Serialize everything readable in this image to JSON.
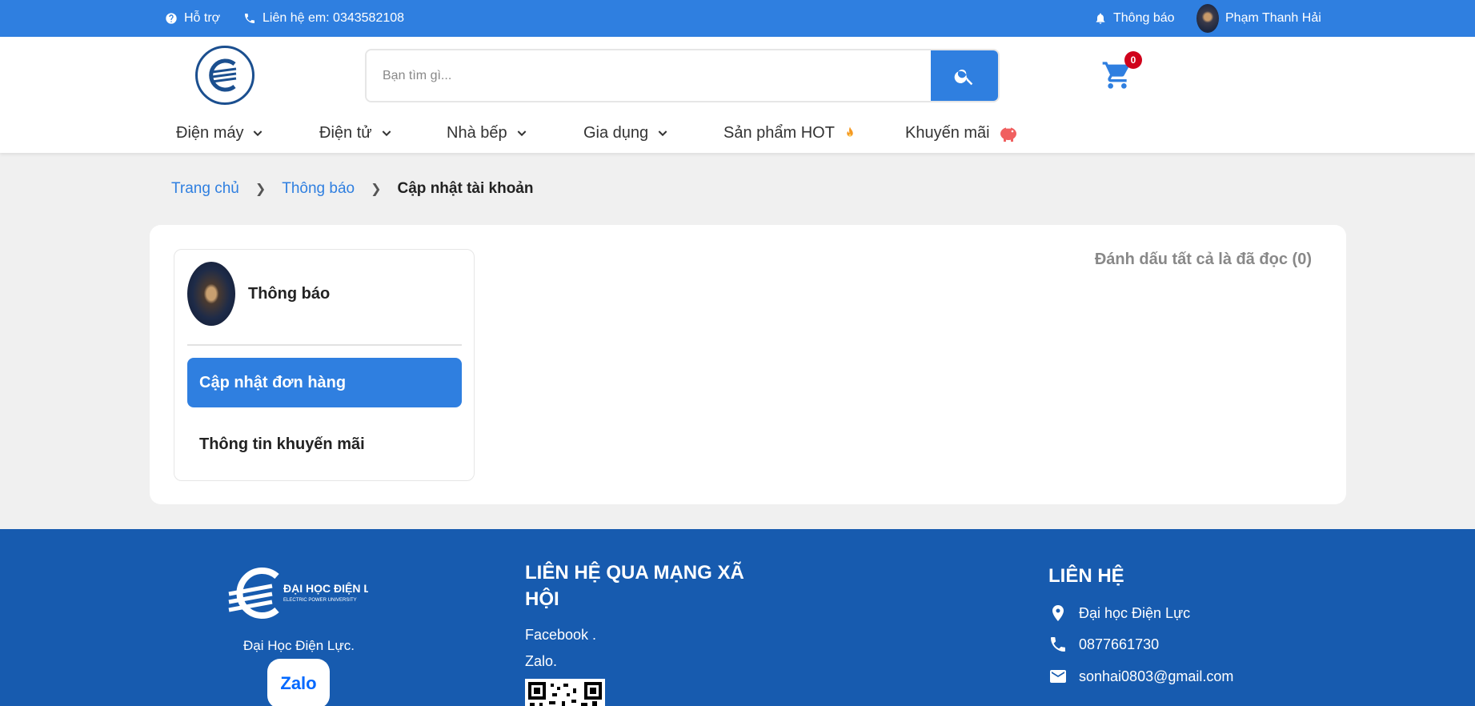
{
  "topbar": {
    "support_label": "Hỗ trợ",
    "contact_label": "Liên hệ em: 0343582108",
    "notify_label": "Thông báo",
    "user_name": "Phạm Thanh Hải"
  },
  "header": {
    "search_placeholder": "Bạn tìm gì...",
    "cart_count": "0",
    "nav": [
      {
        "label": "Điện máy",
        "icon": "chevron-down-icon"
      },
      {
        "label": "Điện tử",
        "icon": "chevron-down-icon"
      },
      {
        "label": "Nhà bếp",
        "icon": "chevron-down-icon"
      },
      {
        "label": "Gia dụng",
        "icon": "chevron-down-icon"
      },
      {
        "label": "Sản phẩm HOT",
        "icon": "fire-icon"
      },
      {
        "label": "Khuyến mãi",
        "icon": "piggy-bank-icon"
      }
    ]
  },
  "breadcrumb": {
    "home": "Trang chủ",
    "notifications": "Thông báo",
    "current": "Cập nhật tài khoản"
  },
  "sidebar": {
    "title": "Thông báo",
    "items": [
      {
        "label": "Cập nhật đơn hàng",
        "active": true
      },
      {
        "label": "Thông tin khuyến mãi",
        "active": false
      }
    ]
  },
  "main": {
    "mark_all_read": "Đánh dấu tất cả là đã đọc (0)"
  },
  "footer": {
    "brand": "Đại Học Điện Lực.",
    "logo_text": "ĐẠI HỌC ĐIỆN LỰC",
    "logo_subtext": "ELECTRIC POWER UNIVERSITY",
    "zalo_label": "Zalo",
    "social_heading": "LIÊN HỆ QUA MẠNG XÃ HỘI",
    "social_links": [
      "Facebook .",
      "Zalo."
    ],
    "contact_heading": "LIÊN HỆ",
    "contact_address": "Đại học Điện Lực",
    "contact_phone": "0877661730",
    "contact_email": "sonhai0803@gmail.com"
  },
  "colors": {
    "primary": "#2f7fe0",
    "footer": "#175baf",
    "badge": "#d0021b"
  }
}
